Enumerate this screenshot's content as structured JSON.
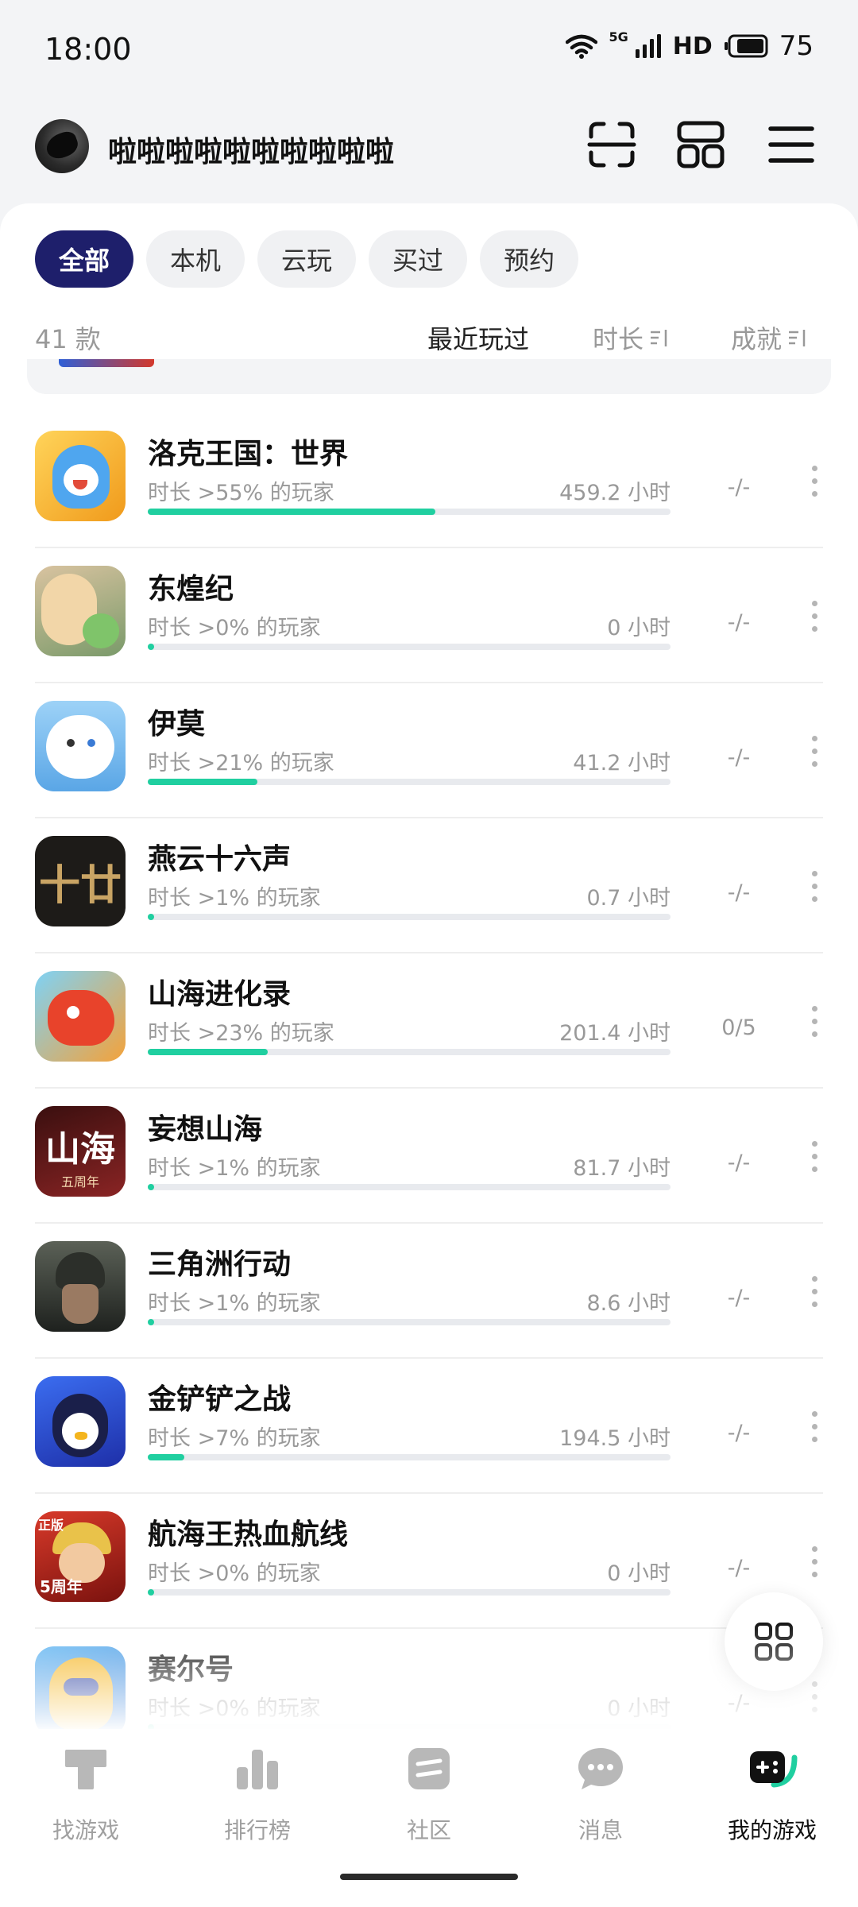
{
  "status": {
    "time": "18:00",
    "network": "5G",
    "hd": "HD",
    "battery": "75"
  },
  "header": {
    "username": "啦啦啦啦啦啦啦啦啦啦"
  },
  "filters": [
    "全部",
    "本机",
    "云玩",
    "买过",
    "预约"
  ],
  "active_filter": "全部",
  "list_info": {
    "count": "41 款",
    "sort_options": {
      "recent": "最近玩过",
      "duration": "时长",
      "achievement": "成就"
    }
  },
  "games": [
    {
      "name": "洛克王国：世界",
      "percentile": "时长 >55% 的玩家",
      "hours": "459.2 小时",
      "progress": 0.55,
      "achievement": "-/-",
      "icon": "roco-kingdom-icon",
      "color": "#f7b928"
    },
    {
      "name": "东煌纪",
      "percentile": "时长 >0% 的玩家",
      "hours": "0 小时",
      "progress": 0.0,
      "achievement": "-/-",
      "icon": "donghuangji-icon",
      "color": "#8fbf6b"
    },
    {
      "name": "伊莫",
      "percentile": "时长 >21% 的玩家",
      "hours": "41.2 小时",
      "progress": 0.21,
      "achievement": "-/-",
      "icon": "yimo-icon",
      "color": "#7fc3f0"
    },
    {
      "name": "燕云十六声",
      "percentile": "时长 >1% 的玩家",
      "hours": "0.7 小时",
      "progress": 0.01,
      "achievement": "-/-",
      "icon": "yanyun-icon",
      "color": "#2a2520"
    },
    {
      "name": "山海进化录",
      "percentile": "时长 >23% 的玩家",
      "hours": "201.4 小时",
      "progress": 0.23,
      "achievement": "0/5",
      "icon": "shanhai-evolution-icon",
      "color": "#f07a2a"
    },
    {
      "name": "妄想山海",
      "percentile": "时长 >1% 的玩家",
      "hours": "81.7 小时",
      "progress": 0.01,
      "achievement": "-/-",
      "icon": "wangxiang-shanhai-icon",
      "color": "#6a1a1a"
    },
    {
      "name": "三角洲行动",
      "percentile": "时长 >1% 的玩家",
      "hours": "8.6 小时",
      "progress": 0.01,
      "achievement": "-/-",
      "icon": "delta-force-icon",
      "color": "#3a3f3a"
    },
    {
      "name": "金铲铲之战",
      "percentile": "时长 >7% 的玩家",
      "hours": "194.5 小时",
      "progress": 0.07,
      "achievement": "-/-",
      "icon": "jinchanchan-icon",
      "color": "#2f5fd6"
    },
    {
      "name": "航海王热血航线",
      "percentile": "时长 >0% 的玩家",
      "hours": "0 小时",
      "progress": 0.0,
      "achievement": "-/-",
      "icon": "one-piece-icon",
      "color": "#c8231c"
    },
    {
      "name": "赛尔号",
      "percentile": "时长 >0% 的玩家",
      "hours": "0 小时",
      "progress": 0.0,
      "achievement": "-/-",
      "icon": "seer-icon",
      "color": "#f2a81c"
    }
  ],
  "icon_text": {
    "yanyun": "十廿",
    "wangxiang": "山海",
    "wangxiang_sub": "五周年",
    "onepiece_tag": "正版",
    "onepiece_sub": "5周年"
  },
  "nav": [
    {
      "label": "找游戏",
      "icon": "find-games-icon"
    },
    {
      "label": "排行榜",
      "icon": "leaderboard-icon"
    },
    {
      "label": "社区",
      "icon": "community-icon"
    },
    {
      "label": "消息",
      "icon": "messages-icon"
    },
    {
      "label": "我的游戏",
      "icon": "my-games-icon"
    }
  ],
  "active_nav": "我的游戏",
  "colors": {
    "accent": "#1e1f6b",
    "progress": "#20cfa0"
  }
}
